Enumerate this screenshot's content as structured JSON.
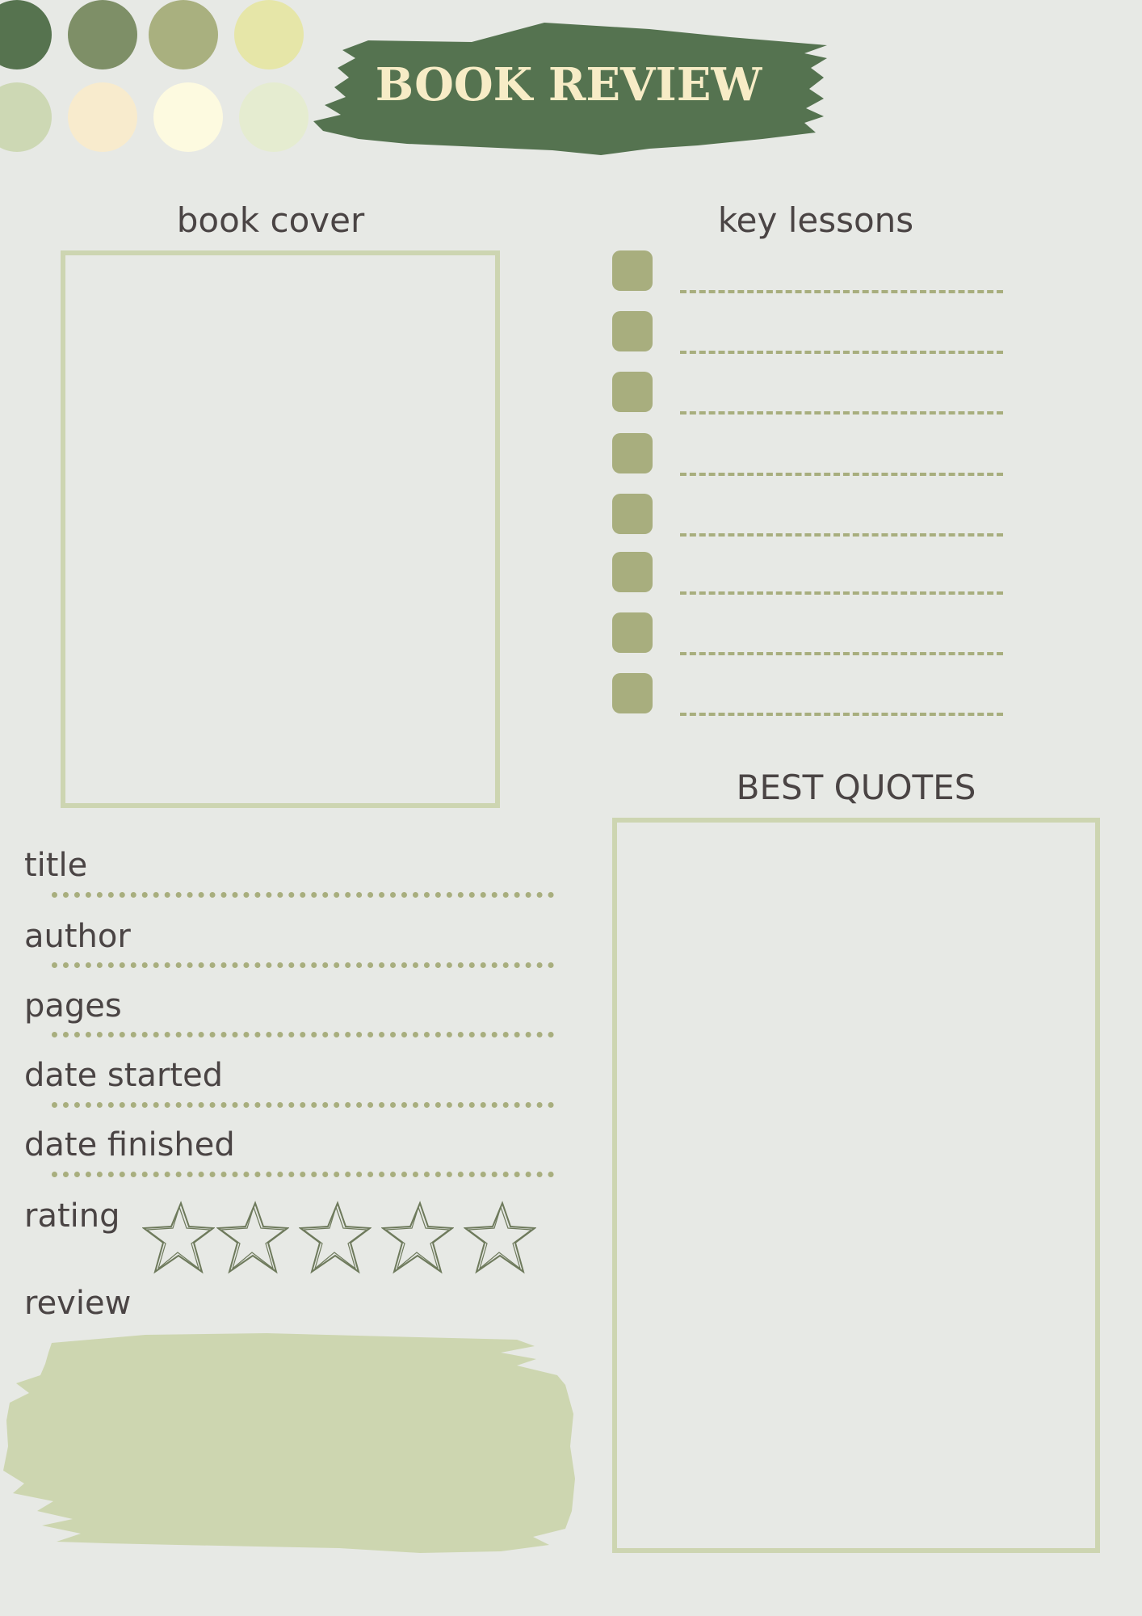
{
  "palette": [
    "#56734f",
    "#7e8f67",
    "#a9b07f",
    "#e6e6a8",
    "#cdd8b4",
    "#f8ebcd",
    "#fdfae0",
    "#e5ecd0"
  ],
  "banner": {
    "title": "BOOK REVIEW",
    "color": "#557350"
  },
  "book_cover": {
    "heading": "book cover"
  },
  "key_lessons": {
    "heading": "key lessons",
    "count": 8
  },
  "best_quotes": {
    "heading": "BEST QUOTES"
  },
  "fields": {
    "title": "title",
    "author": "author",
    "pages": "pages",
    "date_started": "date started",
    "date_finished": "date finished",
    "rating": "rating",
    "review": "review"
  },
  "rating": {
    "max": 5,
    "value": 0
  },
  "colors": {
    "background": "#e7e9e5",
    "accent": "#a8ae7e",
    "frame": "#cdd5b1",
    "review_fill": "#cdd6b0",
    "text": "#4a4444"
  }
}
